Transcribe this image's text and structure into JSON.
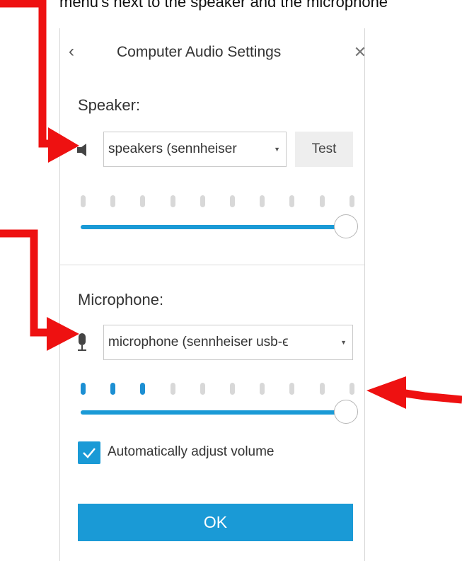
{
  "caption": {
    "text": "menu's next to the speaker and the microphone"
  },
  "dialog": {
    "title": "Computer Audio Settings",
    "back_icon": "chevron-left-icon",
    "close_icon": "close-icon"
  },
  "speaker": {
    "label": "Speaker:",
    "icon": "speaker-icon",
    "device": "speakers (sennheiser",
    "test_label": "Test",
    "level_ticks_total": 10,
    "level_ticks_active": 0,
    "volume": 1.0
  },
  "microphone": {
    "label": "Microphone:",
    "icon": "microphone-icon",
    "device": "microphone (sennheiser usb-ϵ",
    "level_ticks_total": 10,
    "level_ticks_active": 3,
    "volume": 1.0
  },
  "auto_adjust": {
    "label": "Automatically adjust volume",
    "checked": true
  },
  "ok_label": "OK",
  "colors": {
    "accent": "#1a9ad6",
    "tick_active": "#1c8fd3",
    "tick_inactive": "#d8d8d8",
    "annotation_arrow": "#ee1111"
  }
}
